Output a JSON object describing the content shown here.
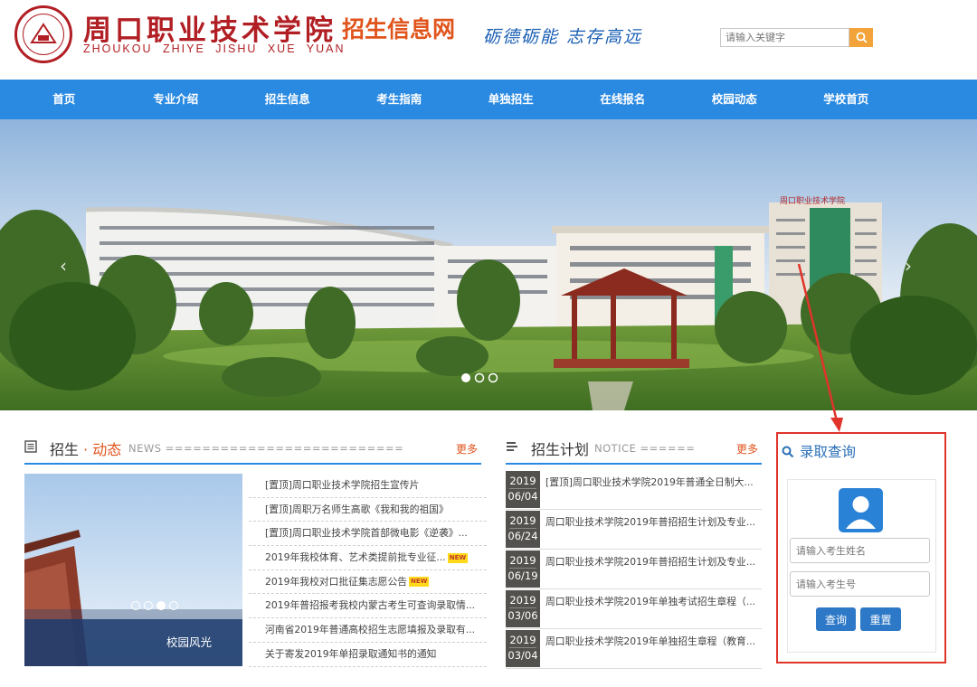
{
  "header": {
    "school_name_cn": "周口职业技术学院",
    "school_name_pinyin": "ZHOUKOU ZHIYE JISHU XUE YUAN",
    "site_title": "招生信息网",
    "motto": "砺德砺能 志存高远",
    "search_placeholder": "请输入关键字",
    "logo_icon": "school-seal-logo",
    "search_icon": "magnifier-icon"
  },
  "nav": {
    "items": [
      {
        "label": "首页"
      },
      {
        "label": "专业介绍"
      },
      {
        "label": "招生信息"
      },
      {
        "label": "考生指南"
      },
      {
        "label": "单独招生"
      },
      {
        "label": "在线报名"
      },
      {
        "label": "校园动态"
      },
      {
        "label": "学校首页"
      }
    ]
  },
  "banner": {
    "building_sign": "周口职业技术学院",
    "slide_count": 3,
    "active_slide": 1
  },
  "news": {
    "title_main": "招生",
    "title_dot": "·",
    "title_accent": "动态",
    "title_en": "NEWS ==========================",
    "more": "更多",
    "photo_caption": "校园风光",
    "photo_dot_count": 4,
    "photo_active_dot": 3,
    "new_badge": "NEW",
    "items": [
      {
        "text": "[置顶]周口职业技术学院招生宣传片",
        "is_new": false
      },
      {
        "text": "[置顶]周职万名师生高歌《我和我的祖国》",
        "is_new": false
      },
      {
        "text": "[置顶]周口职业技术学院首部微电影《逆袭》...",
        "is_new": false
      },
      {
        "text": "2019年我校体育、艺术类提前批专业征...",
        "is_new": true
      },
      {
        "text": "2019年我校对口批征集志愿公告",
        "is_new": true
      },
      {
        "text": "2019年普招报考我校内蒙古考生可查询录取情...",
        "is_new": false
      },
      {
        "text": "河南省2019年普通高校招生志愿填报及录取有...",
        "is_new": false
      },
      {
        "text": "关于寄发2019年单招录取通知书的通知",
        "is_new": false
      }
    ]
  },
  "notice": {
    "title": "招生计划",
    "title_en": "NOTICE ======",
    "more": "更多",
    "items": [
      {
        "year": "2019",
        "date": "06/04",
        "text": "[置顶]周口职业技术学院2019年普通全日制大..."
      },
      {
        "year": "2019",
        "date": "06/24",
        "text": "周口职业技术学院2019年普招招生计划及专业..."
      },
      {
        "year": "2019",
        "date": "06/19",
        "text": "周口职业技术学院2019年普招招生计划及专业..."
      },
      {
        "year": "2019",
        "date": "03/06",
        "text": "周口职业技术学院2019年单独考试招生章程（..."
      },
      {
        "year": "2019",
        "date": "03/04",
        "text": "周口职业技术学院2019年单独招生章程（教育..."
      }
    ]
  },
  "query": {
    "title": "录取查询",
    "name_placeholder": "请输入考生姓名",
    "number_placeholder": "请输入考生号",
    "query_button": "查询",
    "reset_button": "重置",
    "accent_color": "#e0342b"
  },
  "colors": {
    "nav_blue": "#2a8ae2",
    "brand_red": "#b11f24",
    "accent_orange": "#e0541c"
  }
}
